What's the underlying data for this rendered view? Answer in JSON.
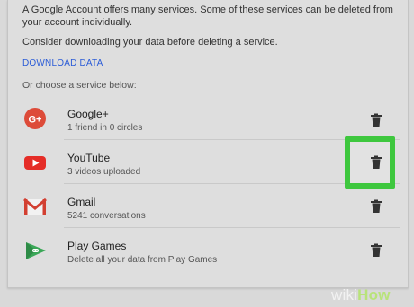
{
  "intro_text": "A Google Account offers many services. Some of these services can be deleted from your account individually.",
  "consider_text": "Consider downloading your data before deleting a service.",
  "download_label": "DOWNLOAD DATA",
  "choose_text": "Or choose a service below:",
  "services": [
    {
      "name": "Google+",
      "sub": "1 friend in 0 circles",
      "icon": "google-plus-icon"
    },
    {
      "name": "YouTube",
      "sub": "3 videos uploaded",
      "icon": "youtube-icon"
    },
    {
      "name": "Gmail",
      "sub": "5241 conversations",
      "icon": "gmail-icon"
    },
    {
      "name": "Play Games",
      "sub": "Delete all your data from Play Games",
      "icon": "play-games-icon"
    }
  ],
  "watermark": {
    "wiki": "wiki",
    "how": "How"
  },
  "colors": {
    "highlight": "#3ec73e",
    "link": "#2a5bd7",
    "google_plus": "#dd4b39",
    "youtube": "#e52d27"
  }
}
